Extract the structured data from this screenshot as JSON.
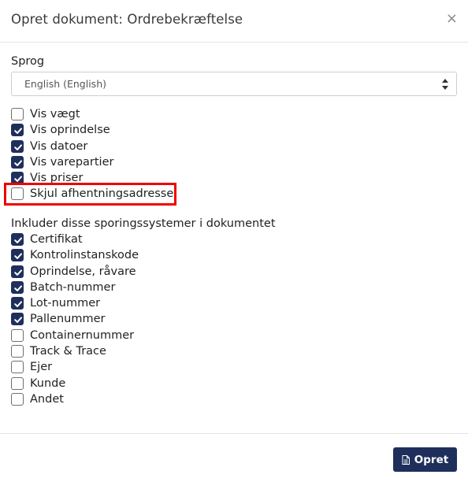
{
  "dialog": {
    "title": "Opret dokument: Ordrebekræftelse",
    "close_glyph": "×"
  },
  "language": {
    "label": "Sprog",
    "selected": "English (English)"
  },
  "options": [
    {
      "label": "Vis vægt",
      "checked": false
    },
    {
      "label": "Vis oprindelse",
      "checked": true
    },
    {
      "label": "Vis datoer",
      "checked": true
    },
    {
      "label": "Vis varepartier",
      "checked": true
    },
    {
      "label": "Vis priser",
      "checked": true
    },
    {
      "label": "Skjul afhentningsadresse",
      "checked": false
    }
  ],
  "tracking": {
    "heading": "Inkluder disse sporingssystemer i dokumentet",
    "items": [
      {
        "label": "Certifikat",
        "checked": true
      },
      {
        "label": "Kontrolinstanskode",
        "checked": true
      },
      {
        "label": "Oprindelse, råvare",
        "checked": true
      },
      {
        "label": "Batch-nummer",
        "checked": true
      },
      {
        "label": "Lot-nummer",
        "checked": true
      },
      {
        "label": "Pallenummer",
        "checked": true
      },
      {
        "label": "Containernummer",
        "checked": false
      },
      {
        "label": "Track & Trace",
        "checked": false
      },
      {
        "label": "Ejer",
        "checked": false
      },
      {
        "label": "Kunde",
        "checked": false
      },
      {
        "label": "Andet",
        "checked": false
      }
    ]
  },
  "footer": {
    "submit_label": "Opret",
    "submit_icon": "document-icon"
  },
  "colors": {
    "primary": "#1f2f5c",
    "highlight": "#f00000"
  }
}
